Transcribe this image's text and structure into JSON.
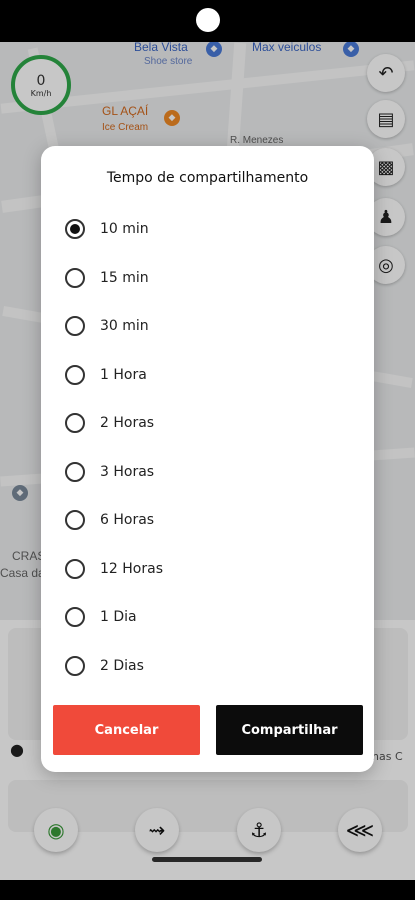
{
  "speedometer": {
    "value": "0",
    "unit": "Km/h",
    "accent_color": "#2fa84a"
  },
  "map": {
    "pois": [
      {
        "name": "Bela Vista",
        "sub": "Shoe store"
      },
      {
        "name": "Max veiculos"
      },
      {
        "name": "GL AÇAÍ",
        "sub": "Ice Cream"
      },
      {
        "name": "R. Menezes"
      },
      {
        "name": "CRAS"
      },
      {
        "name": "Casa da"
      }
    ],
    "panel_text": [
      "nas C"
    ]
  },
  "dialog": {
    "title": "Tempo de compartilhamento",
    "selected_index": 0,
    "options": [
      {
        "label": "10 min",
        "selected": true
      },
      {
        "label": "15 min",
        "selected": false
      },
      {
        "label": "30 min",
        "selected": false
      },
      {
        "label": "1 Hora",
        "selected": false
      },
      {
        "label": "2 Horas",
        "selected": false
      },
      {
        "label": "3 Horas",
        "selected": false
      },
      {
        "label": "6 Horas",
        "selected": false
      },
      {
        "label": "12 Horas",
        "selected": false
      },
      {
        "label": "1 Dia",
        "selected": false
      },
      {
        "label": "2 Dias",
        "selected": false
      }
    ],
    "cancel_label": "Cancelar",
    "share_label": "Compartilhar",
    "cancel_color": "#f04a3a",
    "share_color": "#0c0c0c"
  },
  "icons": {
    "map_buttons": [
      "undo-icon",
      "map-icon",
      "layers-icon",
      "street-view-icon",
      "globe-icon"
    ],
    "nav_buttons": [
      "unlock-icon",
      "route-icon",
      "anchor-icon",
      "share-icon"
    ]
  }
}
